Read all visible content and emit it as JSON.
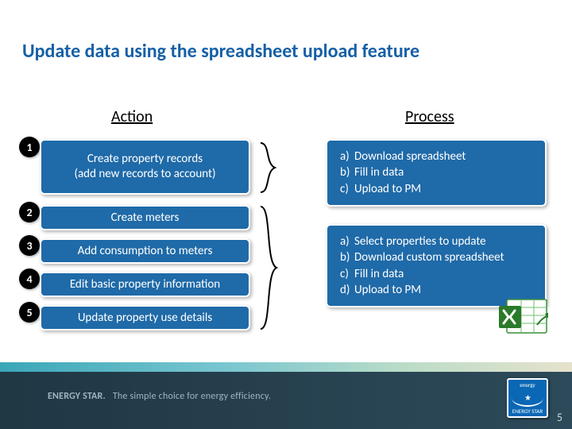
{
  "title": "Update data using the spreadsheet upload feature",
  "columns": {
    "action": "Action",
    "process": "Process"
  },
  "actions": [
    {
      "n": "1",
      "line1": "Create property records",
      "line2": "(add new records to account)"
    },
    {
      "n": "2",
      "label": "Create meters"
    },
    {
      "n": "3",
      "label": "Add consumption to meters"
    },
    {
      "n": "4",
      "label": "Edit basic property information"
    },
    {
      "n": "5",
      "label": "Update property use details"
    }
  ],
  "process1": [
    {
      "k": "a)",
      "v": "Download spreadsheet"
    },
    {
      "k": "b)",
      "v": "Fill in data"
    },
    {
      "k": "c)",
      "v": "Upload to PM"
    }
  ],
  "process2": [
    {
      "k": "a)",
      "v": "Select properties to update"
    },
    {
      "k": "b)",
      "v": "Download custom spreadsheet"
    },
    {
      "k": "c)",
      "v": "Fill in data"
    },
    {
      "k": "d)",
      "v": "Upload to PM"
    }
  ],
  "footer": {
    "brand": "ENERGY STAR.",
    "tagline": "The simple choice for energy efficiency.",
    "logo_text": "energy",
    "logo_bottom": "ENERGY STAR"
  },
  "page_number": "5"
}
